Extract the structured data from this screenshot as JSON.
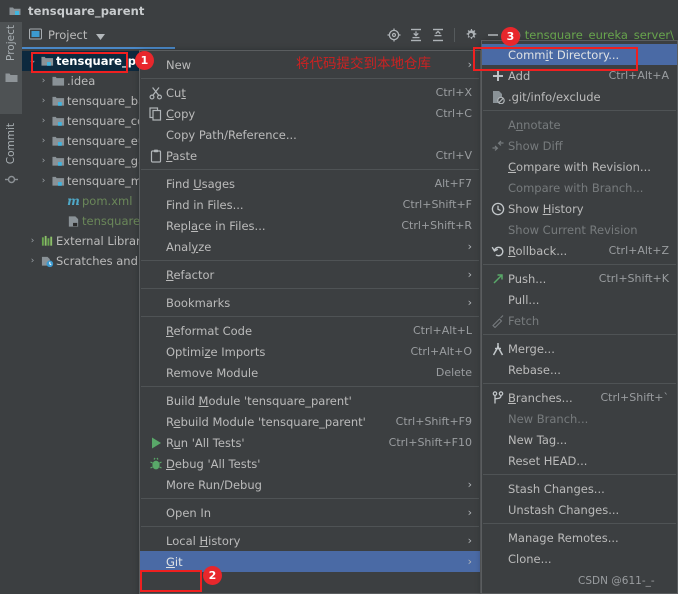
{
  "window": {
    "title": "tensquare_parent",
    "title_icon": "module-folder-icon"
  },
  "tool_tabs": [
    {
      "label": "Project",
      "icon": "project-folder-icon",
      "active": true
    },
    {
      "label": "Commit",
      "icon": "commit-icon",
      "active": false
    }
  ],
  "project_panel": {
    "header_label": "Project",
    "header_icon": "project-view-icon",
    "dropdown_icon": "chevron-down-icon",
    "tree": [
      {
        "label": "tensquare_parent",
        "icon": "module-folder-icon",
        "arrow": "⌄",
        "indent": 0,
        "selected": true,
        "color": "default"
      },
      {
        "label": ".idea",
        "icon": "folder-icon",
        "arrow": "›",
        "indent": 1,
        "selected": false,
        "color": "default"
      },
      {
        "label": "tensquare_base",
        "icon": "module-folder-icon",
        "arrow": "›",
        "indent": 1,
        "selected": false,
        "color": "default"
      },
      {
        "label": "tensquare_common",
        "icon": "module-folder-icon",
        "arrow": "›",
        "indent": 1,
        "selected": false,
        "color": "default"
      },
      {
        "label": "tensquare_eureka",
        "icon": "module-folder-icon",
        "arrow": "›",
        "indent": 1,
        "selected": false,
        "color": "default"
      },
      {
        "label": "tensquare_gathering",
        "icon": "module-folder-icon",
        "arrow": "›",
        "indent": 1,
        "selected": false,
        "color": "default"
      },
      {
        "label": "tensquare_manager",
        "icon": "module-folder-icon",
        "arrow": "›",
        "indent": 1,
        "selected": false,
        "color": "default"
      },
      {
        "label": "pom.xml",
        "icon": "maven-pom-icon",
        "arrow": "",
        "indent": 2,
        "selected": false,
        "color": "green"
      },
      {
        "label": "tensquare_parent.iml",
        "icon": "iml-file-icon",
        "arrow": "",
        "indent": 2,
        "selected": false,
        "color": "green"
      },
      {
        "label": "External Libraries",
        "icon": "libraries-icon",
        "arrow": "›",
        "indent": 0,
        "selected": false,
        "color": "default"
      },
      {
        "label": "Scratches and Consoles",
        "icon": "scratches-icon",
        "arrow": "›",
        "indent": 0,
        "selected": false,
        "color": "default"
      }
    ]
  },
  "toolbar": {
    "icons": [
      {
        "name": "settings-sync-icon",
        "glyph": "⊕"
      },
      {
        "name": "expand-all-icon",
        "glyph": "⤓"
      },
      {
        "name": "collapse-all-icon",
        "glyph": "⤒"
      },
      {
        "name": "gear-icon",
        "glyph": "⚙"
      },
      {
        "name": "hide-icon",
        "glyph": "—"
      }
    ],
    "run_config_label": "tensquare_eureka_server\\",
    "run_config_icon": "spring-boot-icon"
  },
  "context_menu": {
    "items": [
      {
        "label": "New",
        "mnemonic": "",
        "shortcut": "",
        "icon": "",
        "arrow": true,
        "disabled": false,
        "selected": false
      },
      {
        "separator": true
      },
      {
        "label": "Cut",
        "mnemonic": "t",
        "shortcut": "Ctrl+X",
        "icon": "scissors-icon",
        "arrow": false,
        "disabled": false,
        "selected": false
      },
      {
        "label": "Copy",
        "mnemonic": "C",
        "shortcut": "Ctrl+C",
        "icon": "copy-icon",
        "arrow": false,
        "disabled": false,
        "selected": false
      },
      {
        "label": "Copy Path/Reference...",
        "mnemonic": "",
        "shortcut": "",
        "icon": "",
        "arrow": false,
        "disabled": false,
        "selected": false
      },
      {
        "label": "Paste",
        "mnemonic": "P",
        "shortcut": "Ctrl+V",
        "icon": "clipboard-icon",
        "arrow": false,
        "disabled": false,
        "selected": false
      },
      {
        "separator": true
      },
      {
        "label": "Find Usages",
        "mnemonic": "U",
        "shortcut": "Alt+F7",
        "icon": "",
        "arrow": false,
        "disabled": false,
        "selected": false
      },
      {
        "label": "Find in Files...",
        "mnemonic": "",
        "shortcut": "Ctrl+Shift+F",
        "icon": "",
        "arrow": false,
        "disabled": false,
        "selected": false
      },
      {
        "label": "Replace in Files...",
        "mnemonic": "a",
        "shortcut": "Ctrl+Shift+R",
        "icon": "",
        "arrow": false,
        "disabled": false,
        "selected": false
      },
      {
        "label": "Analyze",
        "mnemonic": "y",
        "shortcut": "",
        "icon": "",
        "arrow": true,
        "disabled": false,
        "selected": false
      },
      {
        "separator": true
      },
      {
        "label": "Refactor",
        "mnemonic": "R",
        "shortcut": "",
        "icon": "",
        "arrow": true,
        "disabled": false,
        "selected": false
      },
      {
        "separator": true
      },
      {
        "label": "Bookmarks",
        "mnemonic": "",
        "shortcut": "",
        "icon": "",
        "arrow": true,
        "disabled": false,
        "selected": false
      },
      {
        "separator": true
      },
      {
        "label": "Reformat Code",
        "mnemonic": "R",
        "shortcut": "Ctrl+Alt+L",
        "icon": "",
        "arrow": false,
        "disabled": false,
        "selected": false
      },
      {
        "label": "Optimize Imports",
        "mnemonic": "z",
        "shortcut": "Ctrl+Alt+O",
        "icon": "",
        "arrow": false,
        "disabled": false,
        "selected": false
      },
      {
        "label": "Remove Module",
        "mnemonic": "",
        "shortcut": "Delete",
        "icon": "",
        "arrow": false,
        "disabled": false,
        "selected": false
      },
      {
        "separator": true
      },
      {
        "label": "Build Module 'tensquare_parent'",
        "mnemonic": "M",
        "shortcut": "",
        "icon": "",
        "arrow": false,
        "disabled": false,
        "selected": false
      },
      {
        "label": "Rebuild Module 'tensquare_parent'",
        "mnemonic": "e",
        "shortcut": "Ctrl+Shift+F9",
        "icon": "",
        "arrow": false,
        "disabled": false,
        "selected": false
      },
      {
        "label": "Run 'All Tests'",
        "mnemonic": "u",
        "shortcut": "Ctrl+Shift+F10",
        "icon": "run-icon",
        "arrow": false,
        "disabled": false,
        "selected": false
      },
      {
        "label": "Debug 'All Tests'",
        "mnemonic": "D",
        "shortcut": "",
        "icon": "debug-icon",
        "arrow": false,
        "disabled": false,
        "selected": false
      },
      {
        "label": "More Run/Debug",
        "mnemonic": "",
        "shortcut": "",
        "icon": "",
        "arrow": true,
        "disabled": false,
        "selected": false
      },
      {
        "separator": true
      },
      {
        "label": "Open In",
        "mnemonic": "",
        "shortcut": "",
        "icon": "",
        "arrow": true,
        "disabled": false,
        "selected": false
      },
      {
        "separator": true
      },
      {
        "label": "Local History",
        "mnemonic": "H",
        "shortcut": "",
        "icon": "",
        "arrow": true,
        "disabled": false,
        "selected": false
      },
      {
        "label": "Git",
        "mnemonic": "G",
        "shortcut": "",
        "icon": "",
        "arrow": true,
        "disabled": false,
        "selected": true
      }
    ]
  },
  "git_submenu": {
    "items": [
      {
        "label": "Commit Directory...",
        "mnemonic": "i",
        "shortcut": "",
        "icon": "",
        "arrow": false,
        "disabled": false,
        "selected": true
      },
      {
        "label": "Add",
        "mnemonic": "",
        "shortcut": "Ctrl+Alt+A",
        "icon": "plus-icon",
        "arrow": false,
        "disabled": false,
        "selected": false
      },
      {
        "label": ".git/info/exclude",
        "mnemonic": "",
        "shortcut": "",
        "icon": "ignore-file-icon",
        "arrow": false,
        "disabled": false,
        "selected": false
      },
      {
        "separator": true
      },
      {
        "label": "Annotate",
        "mnemonic": "n",
        "shortcut": "",
        "icon": "",
        "arrow": false,
        "disabled": true,
        "selected": false
      },
      {
        "label": "Show Diff",
        "mnemonic": "",
        "shortcut": "",
        "icon": "diff-icon",
        "arrow": false,
        "disabled": true,
        "selected": false
      },
      {
        "label": "Compare with Revision...",
        "mnemonic": "C",
        "shortcut": "",
        "icon": "",
        "arrow": false,
        "disabled": false,
        "selected": false
      },
      {
        "label": "Compare with Branch...",
        "mnemonic": "",
        "shortcut": "",
        "icon": "",
        "arrow": false,
        "disabled": true,
        "selected": false
      },
      {
        "label": "Show History",
        "mnemonic": "H",
        "shortcut": "",
        "icon": "clock-icon",
        "arrow": false,
        "disabled": false,
        "selected": false
      },
      {
        "label": "Show Current Revision",
        "mnemonic": "",
        "shortcut": "",
        "icon": "",
        "arrow": false,
        "disabled": true,
        "selected": false
      },
      {
        "label": "Rollback...",
        "mnemonic": "R",
        "shortcut": "Ctrl+Alt+Z",
        "icon": "undo-icon",
        "arrow": false,
        "disabled": false,
        "selected": false
      },
      {
        "separator": true
      },
      {
        "label": "Push...",
        "mnemonic": "",
        "shortcut": "Ctrl+Shift+K",
        "icon": "push-icon",
        "arrow": false,
        "disabled": false,
        "selected": false
      },
      {
        "label": "Pull...",
        "mnemonic": "",
        "shortcut": "",
        "icon": "",
        "arrow": false,
        "disabled": false,
        "selected": false
      },
      {
        "label": "Fetch",
        "mnemonic": "",
        "shortcut": "",
        "icon": "fetch-icon",
        "arrow": false,
        "disabled": true,
        "selected": false
      },
      {
        "separator": true
      },
      {
        "label": "Merge...",
        "mnemonic": "",
        "shortcut": "",
        "icon": "merge-icon",
        "arrow": false,
        "disabled": false,
        "selected": false
      },
      {
        "label": "Rebase...",
        "mnemonic": "",
        "shortcut": "",
        "icon": "",
        "arrow": false,
        "disabled": false,
        "selected": false
      },
      {
        "separator": true
      },
      {
        "label": "Branches...",
        "mnemonic": "B",
        "shortcut": "Ctrl+Shift+`",
        "icon": "branch-icon",
        "arrow": false,
        "disabled": false,
        "selected": false
      },
      {
        "label": "New Branch...",
        "mnemonic": "",
        "shortcut": "",
        "icon": "",
        "arrow": false,
        "disabled": true,
        "selected": false
      },
      {
        "label": "New Tag...",
        "mnemonic": "",
        "shortcut": "",
        "icon": "",
        "arrow": false,
        "disabled": false,
        "selected": false
      },
      {
        "label": "Reset HEAD...",
        "mnemonic": "",
        "shortcut": "",
        "icon": "",
        "arrow": false,
        "disabled": false,
        "selected": false
      },
      {
        "separator": true
      },
      {
        "label": "Stash Changes...",
        "mnemonic": "",
        "shortcut": "",
        "icon": "",
        "arrow": false,
        "disabled": false,
        "selected": false
      },
      {
        "label": "Unstash Changes...",
        "mnemonic": "",
        "shortcut": "",
        "icon": "",
        "arrow": false,
        "disabled": false,
        "selected": false
      },
      {
        "separator": true
      },
      {
        "label": "Manage Remotes...",
        "mnemonic": "",
        "shortcut": "",
        "icon": "",
        "arrow": false,
        "disabled": false,
        "selected": false
      },
      {
        "label": "Clone...",
        "mnemonic": "",
        "shortcut": "",
        "icon": "",
        "arrow": false,
        "disabled": false,
        "selected": false
      }
    ]
  },
  "annotations": {
    "badge_1": "1",
    "badge_2": "2",
    "badge_3": "3",
    "note_zh": "将代码提交到本地仓库",
    "watermark": "CSDN @611-_-",
    "accent_red": "#e8272c",
    "accent_blue": "#4a6aa5",
    "selection_blue": "#4a88c7"
  }
}
